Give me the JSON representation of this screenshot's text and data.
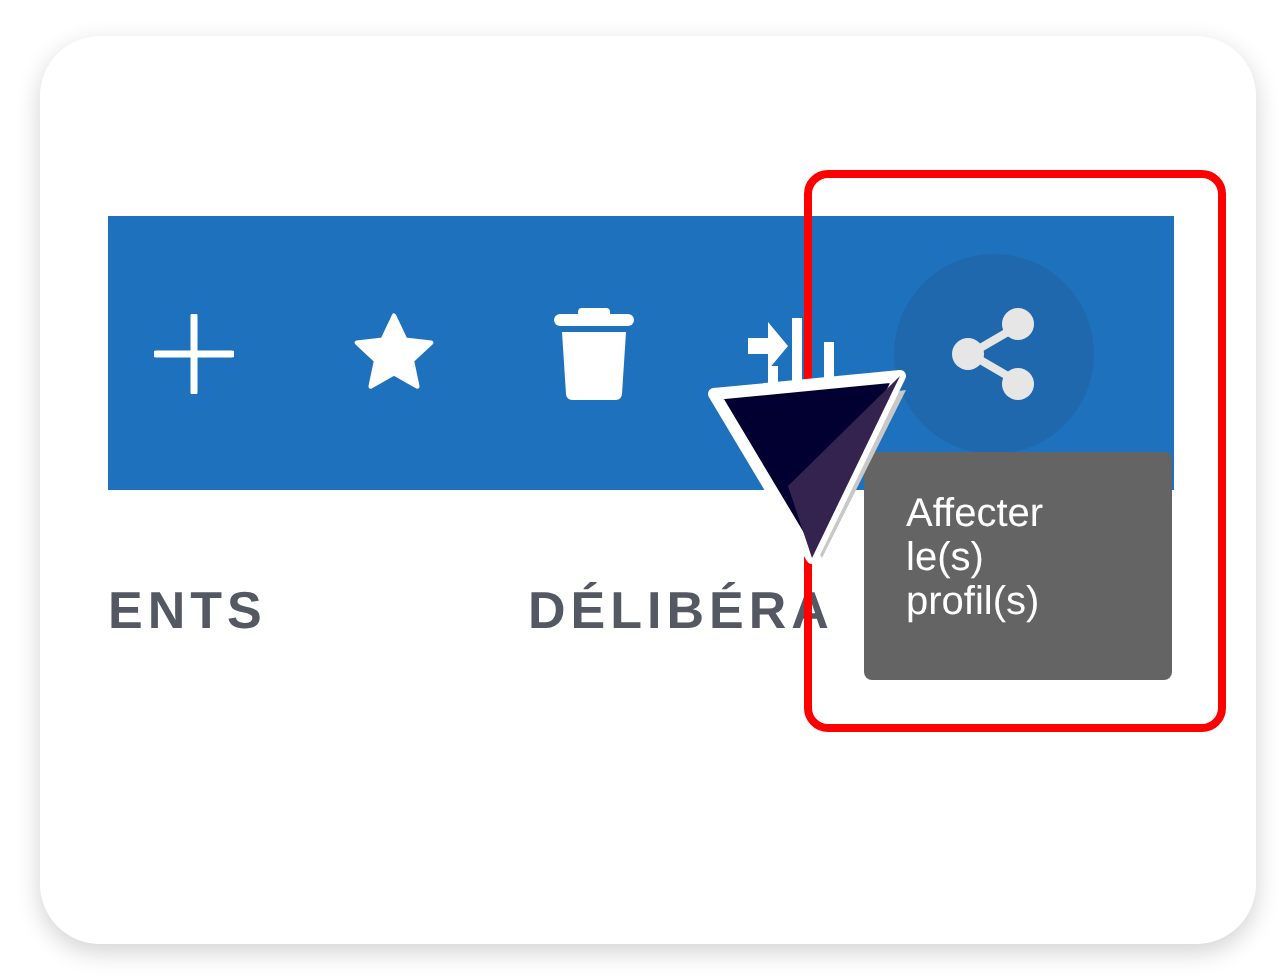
{
  "toolbar": {
    "buttons": [
      {
        "kind": "add",
        "highlighted": false
      },
      {
        "kind": "favorite",
        "highlighted": false
      },
      {
        "kind": "delete",
        "highlighted": false
      },
      {
        "kind": "move",
        "highlighted": false
      },
      {
        "kind": "share",
        "highlighted": true
      }
    ]
  },
  "tabs": [
    {
      "label": "ENTS"
    },
    {
      "label": "DÉLIBÉRA"
    }
  ],
  "tooltip": {
    "text": "Affecter le(s) profil(s)"
  }
}
